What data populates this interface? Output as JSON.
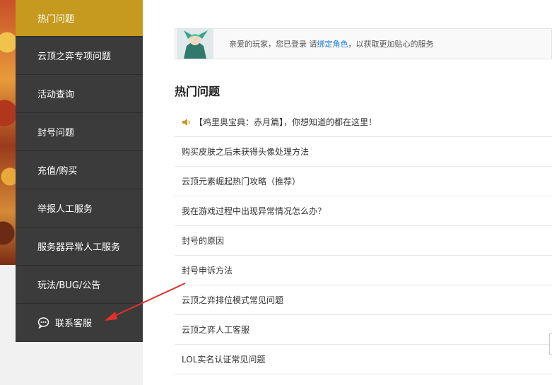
{
  "sidebar": {
    "items": [
      {
        "label": "热门问题",
        "active": true
      },
      {
        "label": "云顶之弈专项问题"
      },
      {
        "label": "活动查询"
      },
      {
        "label": "封号问题"
      },
      {
        "label": "充值/购买"
      },
      {
        "label": "举报人工服务"
      },
      {
        "label": "服务器异常人工服务"
      },
      {
        "label": "玩法/BUG/公告"
      }
    ],
    "contact": {
      "label": "联系客服",
      "icon": "chat-bubble-icon"
    }
  },
  "banner": {
    "text_before": "亲爱的玩家，您已登录 请",
    "link": "绑定角色",
    "text_after": "，以获取更加贴心的服务"
  },
  "section": {
    "title": "热门问题"
  },
  "questions": [
    {
      "label": "【鸡里奥宝典：赤月篇】，你想知道的都在这里！",
      "icon": "speaker-icon"
    },
    {
      "label": "购买皮肤之后未获得头像处理方法"
    },
    {
      "label": "云顶元素崛起热门攻略（推荐）"
    },
    {
      "label": "我在游戏过程中出现异常情况怎么办？"
    },
    {
      "label": "封号的原因"
    },
    {
      "label": "封号申诉方法"
    },
    {
      "label": "云顶之弈排位模式常见问题"
    },
    {
      "label": "云顶之弈人工客服"
    },
    {
      "label": "LOL实名认证常见问题"
    }
  ],
  "colors": {
    "accent": "#c59a1e",
    "sidebar": "#3b3b3b",
    "link": "#1e7bd0",
    "arrow": "#e0322b"
  }
}
